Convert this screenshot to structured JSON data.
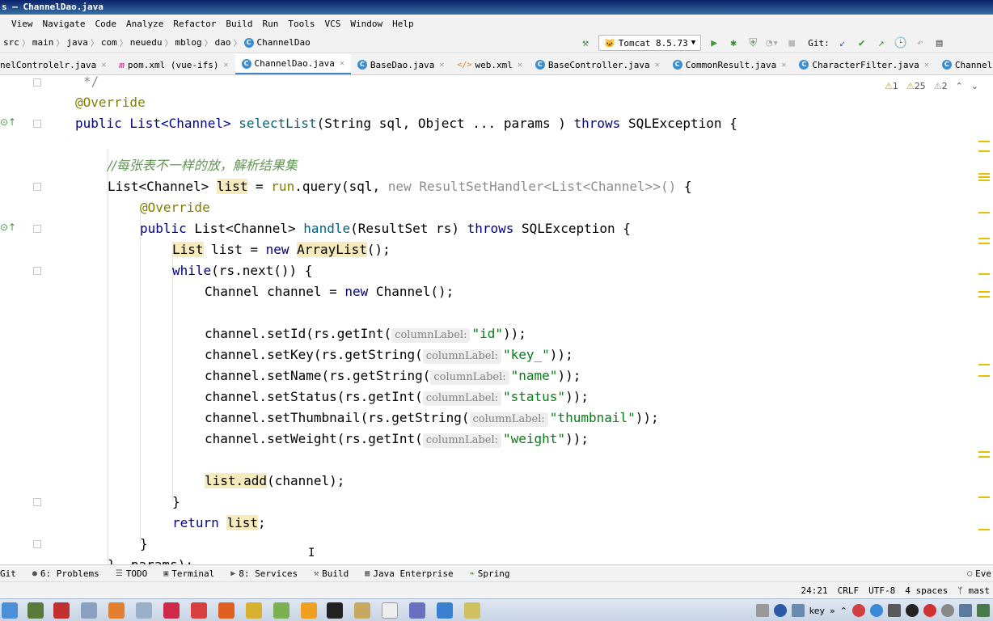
{
  "window": {
    "title": "s — ChannelDao.java"
  },
  "menu": [
    "View",
    "Navigate",
    "Code",
    "Analyze",
    "Refactor",
    "Build",
    "Run",
    "Tools",
    "VCS",
    "Window",
    "Help"
  ],
  "breadcrumb": [
    "src",
    "main",
    "java",
    "com",
    "neuedu",
    "mblog",
    "dao",
    "ChannelDao"
  ],
  "toolbar": {
    "run_config": "Tomcat 8.5.73",
    "git_label": "Git:"
  },
  "tabs": [
    {
      "label": "nelControlelr.java"
    },
    {
      "label": "pom.xml (vue-ifs)"
    },
    {
      "label": "ChannelDao.java"
    },
    {
      "label": "BaseDao.java"
    },
    {
      "label": "web.xml"
    },
    {
      "label": "BaseController.java"
    },
    {
      "label": "CommonResult.java"
    },
    {
      "label": "CharacterFilter.java"
    },
    {
      "label": "ChannelServi"
    }
  ],
  "inspections": {
    "errors": "1",
    "warnings": "25",
    "weak": "2"
  },
  "code": {
    "l0": "*/",
    "l1": "@Override",
    "l2_a": "public List<Channel> ",
    "l2_fn": "selectList",
    "l2_b": "(String sql, Object ... params ) ",
    "l2_kw": "throws",
    "l2_c": " SQLException {",
    "l4": "//每张表不一样的放，解析结果集",
    "l5_a": "List<Channel> ",
    "l5_var": "list",
    "l5_b": " = ",
    "l5_run": "run",
    "l5_c": ".query(sql, ",
    "l5_d": "new ResultSetHandler<List<Channel>>()",
    "l5_e": " {",
    "l6": "@Override",
    "l7_kw": "public",
    "l7_a": " List<Channel> ",
    "l7_fn": "handle",
    "l7_b": "(ResultSet rs) ",
    "l7_kw2": "throws",
    "l7_c": " SQLException {",
    "l8_a": "List",
    "l8_b": " list = ",
    "l8_kw": "new",
    "l8_c": " ",
    "l8_d": "ArrayList",
    "l8_e": "();",
    "l9_kw": "while",
    "l9_a": "(rs.next()) {",
    "l10_a": "Channel channel = ",
    "l10_kw": "new",
    "l10_b": " Channel();",
    "hint": "columnLabel:",
    "setters": [
      {
        "call": "channel.setId(rs.getInt(",
        "arg": "\"id\"",
        "end": "));"
      },
      {
        "call": "channel.setKey(rs.getString(",
        "arg": "\"key_\"",
        "end": "));"
      },
      {
        "call": "channel.setName(rs.getString(",
        "arg": "\"name\"",
        "end": "));"
      },
      {
        "call": "channel.setStatus(rs.getInt(",
        "arg": "\"status\"",
        "end": "));"
      },
      {
        "call": "channel.setThumbnail(rs.getString(",
        "arg": "\"thumbnail\"",
        "end": "));"
      },
      {
        "call": "channel.setWeight(rs.getInt(",
        "arg": "\"weight\"",
        "end": "));"
      }
    ],
    "l19_a": "list.add",
    "l19_b": "(channel);",
    "l20": "}",
    "l21_kw": "return",
    "l21_a": " ",
    "l21_var": "list",
    "l21_b": ";",
    "l22": "}",
    "l23": "}, params);"
  },
  "tool_windows": [
    "Git",
    "6: Problems",
    "TODO",
    "Terminal",
    "8: Services",
    "Build",
    "Java Enterprise",
    "Spring",
    "Eve"
  ],
  "status": {
    "position": "24:21",
    "line_sep": "CRLF",
    "encoding": "UTF-8",
    "indent": "4 spaces",
    "branch": "mast"
  },
  "tray": {
    "ime": "key"
  }
}
